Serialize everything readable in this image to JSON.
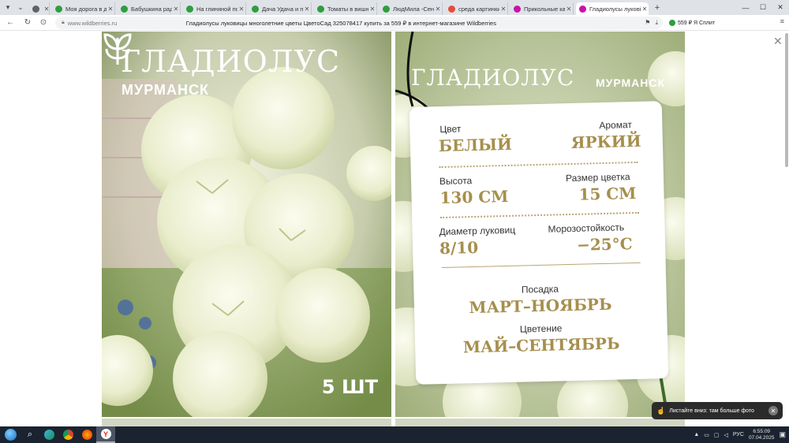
{
  "tabs": [
    {
      "label": "",
      "color": "#5f6368",
      "active": false
    },
    {
      "label": "Моя дорога в достатв",
      "color": "#2e9e3f",
      "active": false
    },
    {
      "label": "Бабушкина радос",
      "color": "#2e9e3f",
      "active": false
    },
    {
      "label": "На глиняной подг",
      "color": "#2e9e3f",
      "active": false
    },
    {
      "label": "Дача Удача и пчёл",
      "color": "#2e9e3f",
      "active": false
    },
    {
      "label": "Томаты в вишнёв",
      "color": "#2e9e3f",
      "active": false
    },
    {
      "label": "ЛюдМила -Сеньо",
      "color": "#2e9e3f",
      "active": false
    },
    {
      "label": "среда картинки п",
      "color": "#e74c3c",
      "active": false
    },
    {
      "label": "Прикольные карти",
      "color": "#cb11ab",
      "active": false
    },
    {
      "label": "Гладиолусы лукові",
      "color": "#cb11ab",
      "active": true
    }
  ],
  "address": {
    "domain": "www.wildberries.ru",
    "title": "Гладиолусы луковицы многолетние цветы ЦветоСад 325078417 купить за 559 ₽ в интернет-магазине Wildberries",
    "price_extension": "559 ₽ Я Сплит"
  },
  "product_left": {
    "title": "ГЛАДИОЛУС",
    "variety": "МУРМАНСК",
    "quantity": "5 ШТ"
  },
  "product_right": {
    "title": "ГЛАДИОЛУС",
    "variety": "МУРМАНСК",
    "color_label": "Цвет",
    "color_value": "БЕЛЫЙ",
    "aroma_label": "Аромат",
    "aroma_value": "ЯРКИЙ",
    "height_label": "Высота",
    "height_value": "130 СМ",
    "flower_size_label": "Размер цветка",
    "flower_size_value": "15 СМ",
    "bulb_diameter_label": "Диаметр луковиц",
    "bulb_diameter_value": "8/10",
    "frost_label": "Морозостойкость",
    "frost_value": "−25°С",
    "planting_label": "Посадка",
    "planting_value": "МАРТ–НОЯБРЬ",
    "bloom_label": "Цветение",
    "bloom_value": "МАЙ–СЕНТЯБРЬ"
  },
  "toast": {
    "text": "Листайте вниз: там больше фото"
  },
  "taskbar": {
    "lang": "РУС",
    "time": "6:55:09",
    "date": "07.04.2025"
  },
  "colors": {
    "accent_gold": "#a68f4e",
    "taskbar": "#1b2330",
    "wb_purple": "#cb11ab"
  }
}
